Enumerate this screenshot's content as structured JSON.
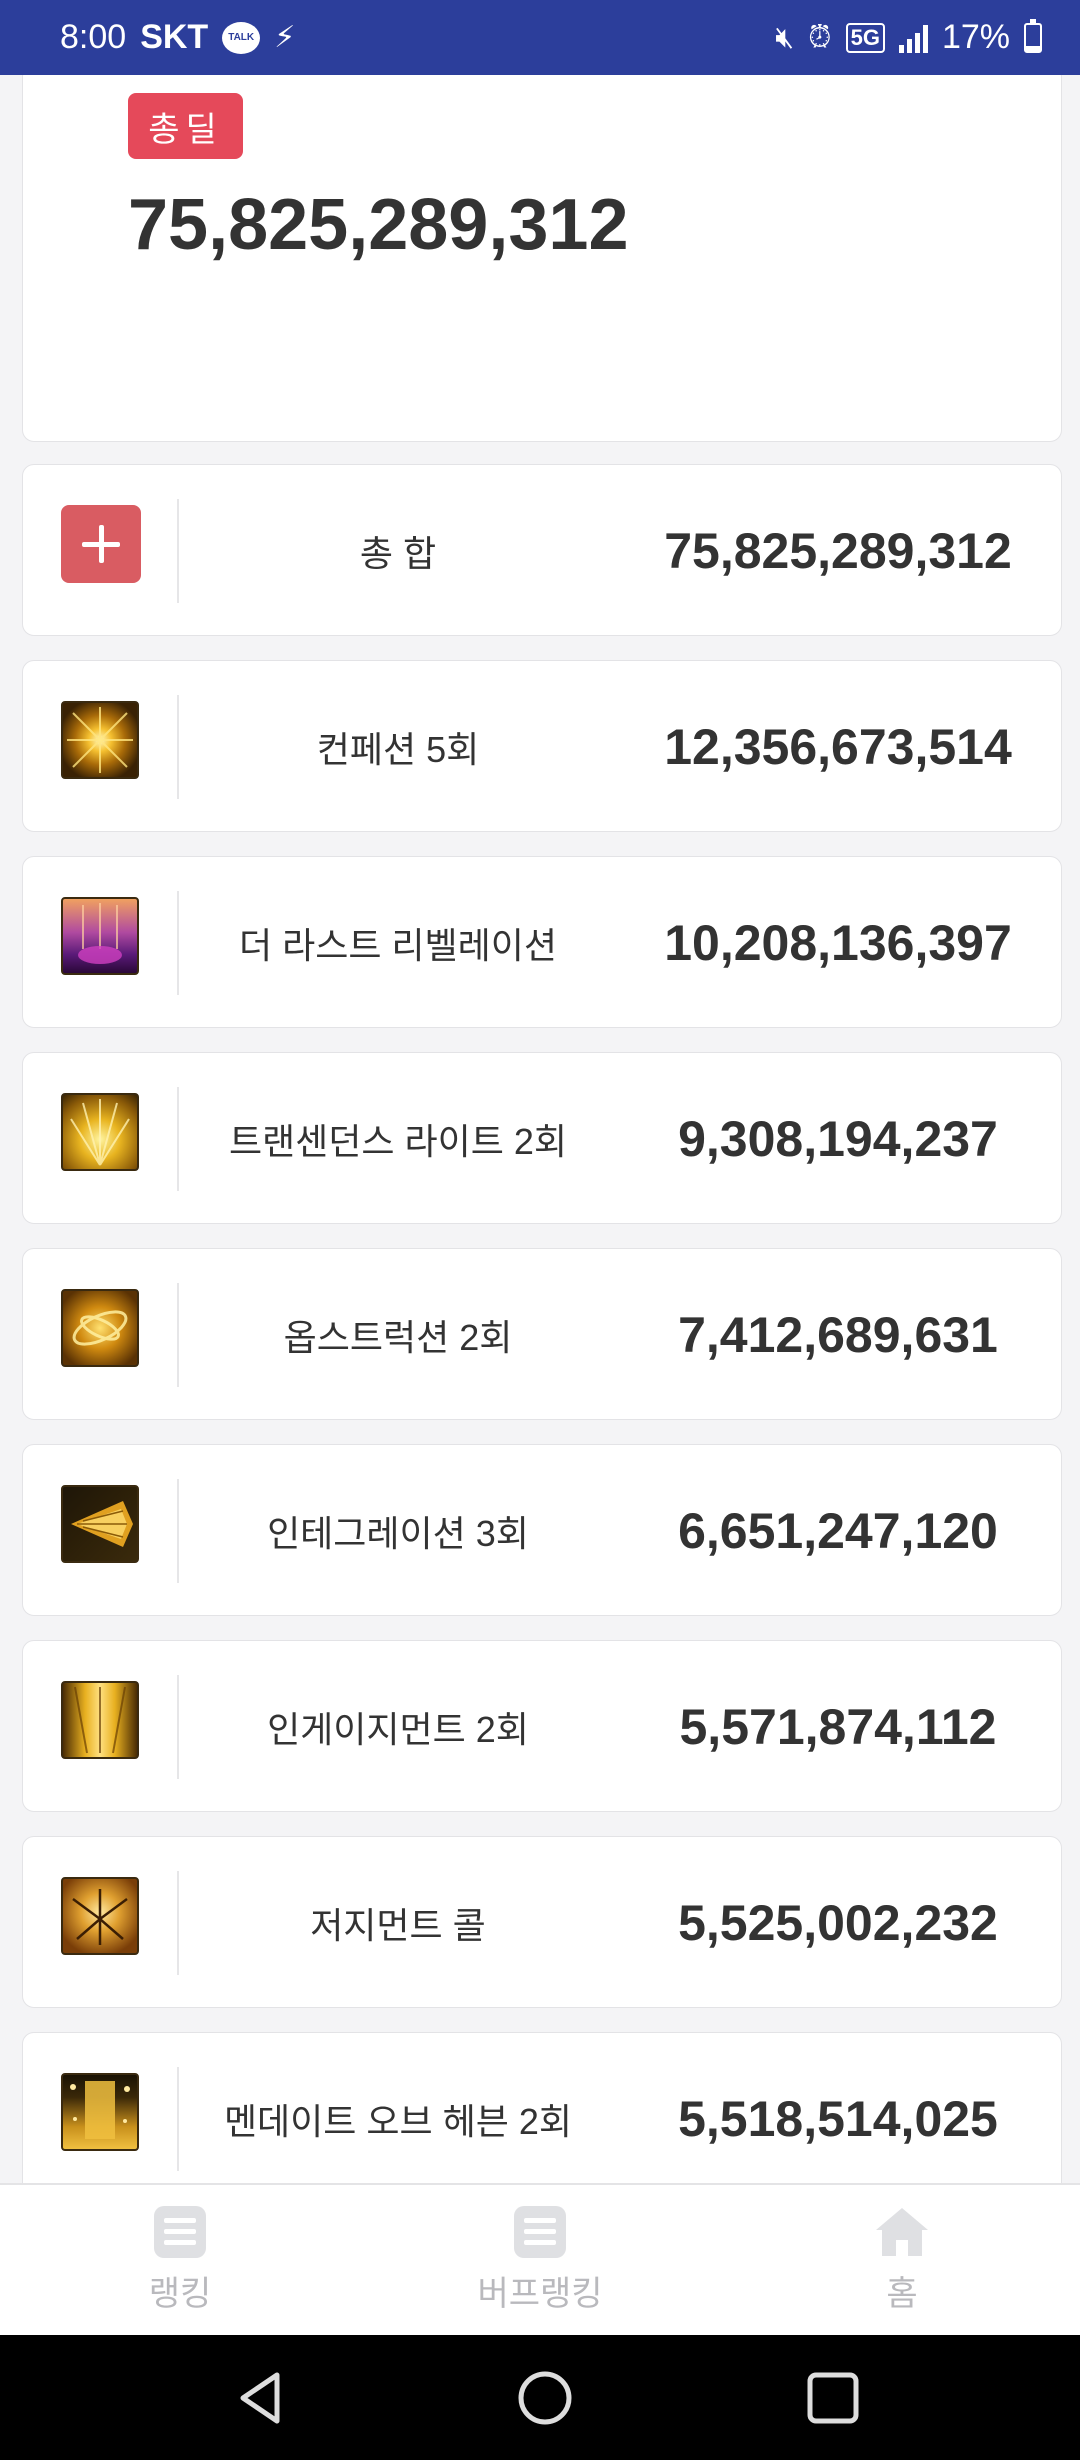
{
  "status_bar": {
    "time": "8:00",
    "carrier": "SKT",
    "talk_label": "TALK",
    "battery": "17%",
    "battery_level": 0.17
  },
  "summary": {
    "badge": "총딜",
    "total": "75,825,289,312"
  },
  "rows": [
    {
      "name": "총 합",
      "value": "75,825,289,312",
      "icon": "plus-icon"
    },
    {
      "name": "컨페션 5회",
      "value": "12,356,673,514",
      "icon": "confession-skill-icon"
    },
    {
      "name": "더 라스트 리벨레이션",
      "value": "10,208,136,397",
      "icon": "last-revelation-skill-icon"
    },
    {
      "name": "트랜센던스 라이트 2회",
      "value": "9,308,194,237",
      "icon": "transcendence-light-skill-icon"
    },
    {
      "name": "옵스트럭션 2회",
      "value": "7,412,689,631",
      "icon": "obstruction-skill-icon"
    },
    {
      "name": "인테그레이션 3회",
      "value": "6,651,247,120",
      "icon": "integration-skill-icon"
    },
    {
      "name": "인게이지먼트 2회",
      "value": "5,571,874,112",
      "icon": "engagement-skill-icon"
    },
    {
      "name": "저지먼트 콜",
      "value": "5,525,002,232",
      "icon": "judgement-call-skill-icon"
    },
    {
      "name": "멘데이트 오브 헤븐 2회",
      "value": "5,518,514,025",
      "icon": "mandate-of-heaven-skill-icon"
    }
  ],
  "bottom_nav": {
    "ranking": "랭킹",
    "buff_ranking": "버프랭킹",
    "home": "홈"
  },
  "colors": {
    "status_bar": "#2c3e9b",
    "badge": "#e5495a",
    "plus_icon": "#d95c62"
  }
}
